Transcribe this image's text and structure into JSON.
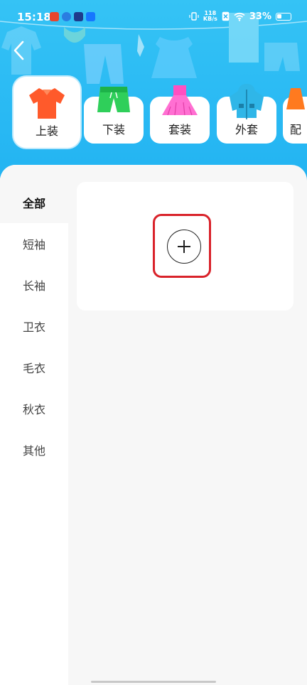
{
  "status_bar": {
    "time": "15:18",
    "net_speed_value": "118",
    "net_speed_unit": "KB/s",
    "battery_percent": "33%",
    "app_icons": [
      "app-icon-red",
      "app-icon-blue-swirl",
      "app-icon-video",
      "app-icon-alipay"
    ],
    "icons": [
      "vibrate-icon",
      "no-sim-icon",
      "wifi-icon",
      "battery-icon"
    ]
  },
  "header": {
    "back_icon": "back-arrow-icon",
    "accent": "#22b3f2"
  },
  "categories": [
    {
      "label": "上装",
      "icon": "shirt-icon",
      "active": true
    },
    {
      "label": "下装",
      "icon": "shorts-icon",
      "active": false
    },
    {
      "label": "套装",
      "icon": "dress-icon",
      "active": false
    },
    {
      "label": "外套",
      "icon": "jacket-icon",
      "active": false
    },
    {
      "label": "配",
      "icon": "accessory-icon",
      "active": false
    }
  ],
  "sidebar": {
    "items": [
      {
        "label": "全部",
        "active": true
      },
      {
        "label": "短袖",
        "active": false
      },
      {
        "label": "长袖",
        "active": false
      },
      {
        "label": "卫衣",
        "active": false
      },
      {
        "label": "毛衣",
        "active": false
      },
      {
        "label": "秋衣",
        "active": false
      },
      {
        "label": "其他",
        "active": false
      }
    ]
  },
  "content": {
    "add_button_icon": "plus-circle-icon",
    "highlight_color": "#d9222a"
  }
}
